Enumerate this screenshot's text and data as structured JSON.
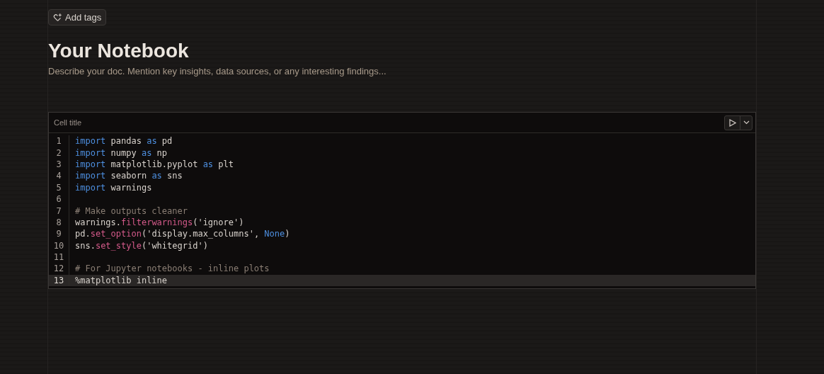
{
  "tags_button": {
    "label": "Add tags"
  },
  "title": "Your Notebook",
  "description": {
    "placeholder": "Describe your doc. Mention key insights, data sources, or any interesting findings..."
  },
  "cell": {
    "title": "Cell title",
    "lines": [
      {
        "number": "1",
        "current": false,
        "tokens": [
          {
            "text": "import",
            "kind": "keyword"
          },
          {
            "text": " pandas ",
            "kind": "plain"
          },
          {
            "text": "as",
            "kind": "keyword"
          },
          {
            "text": " pd",
            "kind": "plain"
          }
        ]
      },
      {
        "number": "2",
        "current": false,
        "tokens": [
          {
            "text": "import",
            "kind": "keyword"
          },
          {
            "text": " numpy ",
            "kind": "plain"
          },
          {
            "text": "as",
            "kind": "keyword"
          },
          {
            "text": " np",
            "kind": "plain"
          }
        ]
      },
      {
        "number": "3",
        "current": false,
        "tokens": [
          {
            "text": "import",
            "kind": "keyword"
          },
          {
            "text": " matplotlib.pyplot ",
            "kind": "plain"
          },
          {
            "text": "as",
            "kind": "keyword"
          },
          {
            "text": " plt",
            "kind": "plain"
          }
        ]
      },
      {
        "number": "4",
        "current": false,
        "tokens": [
          {
            "text": "import",
            "kind": "keyword"
          },
          {
            "text": " seaborn ",
            "kind": "plain"
          },
          {
            "text": "as",
            "kind": "keyword"
          },
          {
            "text": " sns",
            "kind": "plain"
          }
        ]
      },
      {
        "number": "5",
        "current": false,
        "tokens": [
          {
            "text": "import",
            "kind": "keyword"
          },
          {
            "text": " warnings",
            "kind": "plain"
          }
        ]
      },
      {
        "number": "6",
        "current": false
      },
      {
        "number": "7",
        "current": false,
        "tokens": [
          {
            "text": "# Make outputs cleaner",
            "kind": "comment"
          }
        ]
      },
      {
        "number": "8",
        "current": false,
        "tokens": [
          {
            "text": "warnings.",
            "kind": "plain"
          },
          {
            "text": "filterwarnings",
            "kind": "function"
          },
          {
            "text": "('ignore')",
            "kind": "plain"
          }
        ]
      },
      {
        "number": "9",
        "current": false,
        "tokens": [
          {
            "text": "pd.",
            "kind": "plain"
          },
          {
            "text": "set_option",
            "kind": "function"
          },
          {
            "text": "('display.max_columns', ",
            "kind": "plain"
          },
          {
            "text": "None",
            "kind": "constant"
          },
          {
            "text": ")",
            "kind": "plain"
          }
        ]
      },
      {
        "number": "10",
        "current": false,
        "tokens": [
          {
            "text": "sns.",
            "kind": "plain"
          },
          {
            "text": "set_style",
            "kind": "function"
          },
          {
            "text": "('whitegrid')",
            "kind": "plain"
          }
        ]
      },
      {
        "number": "11",
        "current": false
      },
      {
        "number": "12",
        "current": false,
        "tokens": [
          {
            "text": "# For Jupyter notebooks - inline plots",
            "kind": "comment"
          }
        ]
      },
      {
        "number": "13",
        "current": true,
        "tokens": [
          {
            "text": "%matplotlib inline",
            "kind": "plain"
          }
        ]
      }
    ]
  }
}
